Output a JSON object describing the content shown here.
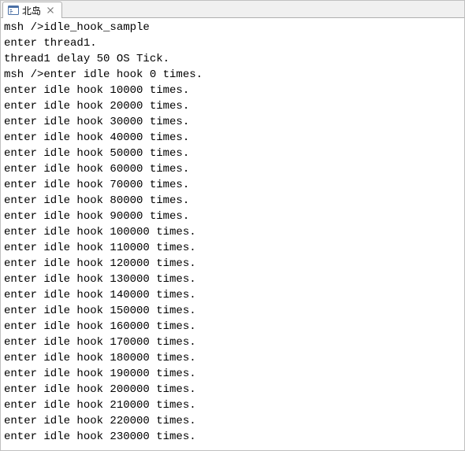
{
  "tab": {
    "label": "北岛",
    "close_symbol": "✕"
  },
  "console": {
    "lines": [
      "msh />idle_hook_sample",
      "enter thread1.",
      "thread1 delay 50 OS Tick.",
      "msh />enter idle hook 0 times.",
      "enter idle hook 10000 times.",
      "enter idle hook 20000 times.",
      "enter idle hook 30000 times.",
      "enter idle hook 40000 times.",
      "enter idle hook 50000 times.",
      "enter idle hook 60000 times.",
      "enter idle hook 70000 times.",
      "enter idle hook 80000 times.",
      "enter idle hook 90000 times.",
      "enter idle hook 100000 times.",
      "enter idle hook 110000 times.",
      "enter idle hook 120000 times.",
      "enter idle hook 130000 times.",
      "enter idle hook 140000 times.",
      "enter idle hook 150000 times.",
      "enter idle hook 160000 times.",
      "enter idle hook 170000 times.",
      "enter idle hook 180000 times.",
      "enter idle hook 190000 times.",
      "enter idle hook 200000 times.",
      "enter idle hook 210000 times.",
      "enter idle hook 220000 times.",
      "enter idle hook 230000 times."
    ]
  }
}
